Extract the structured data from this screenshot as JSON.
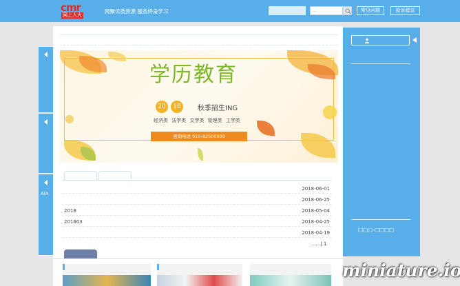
{
  "header": {
    "logo_mark": "cmr",
    "logo_sub": "网上人大",
    "slogan": "网聚优质资源 服务终身学习",
    "search_placeholder": "...",
    "faq_label": "常见问题",
    "feedback_label": "投诉建议"
  },
  "left_tabs": [
    {
      "label": ""
    },
    {
      "label": ""
    },
    {
      "label": "AIA"
    }
  ],
  "banner": {
    "title": "学历教育",
    "year_a": "20",
    "year_b": "18",
    "season": "秋季招生ING",
    "categories": "经济类 法学类 文学类 管理类 工学类",
    "phone": "咨询电话 010-82500000"
  },
  "news": {
    "items": [
      {
        "title": "",
        "date": "2018-06-01"
      },
      {
        "title": "",
        "date": "2018-06-25"
      },
      {
        "title": "2018",
        "date": "2018-05-04"
      },
      {
        "title": "201803",
        "date": "2018-04-25"
      },
      {
        "title": "",
        "date": "2018-04-19"
      }
    ],
    "pager": "......| 1"
  },
  "sidebar": {
    "link_label": "□□□-□□□□"
  },
  "watermark": "miniature.io",
  "colors": {
    "brand_blue": "#58aee8",
    "logo_red": "#e02b2b",
    "banner_green": "#7db829",
    "banner_orange": "#ee8a1e"
  }
}
